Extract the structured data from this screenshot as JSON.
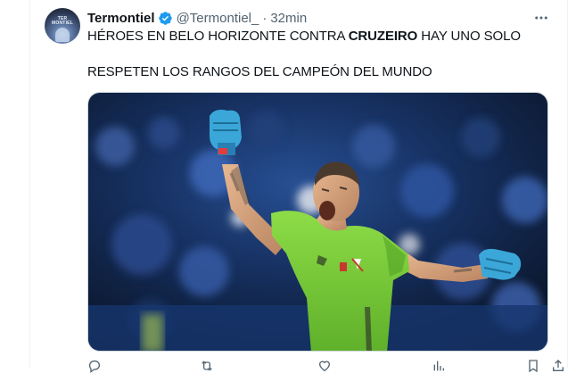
{
  "tweet": {
    "author_name": "Termontiel",
    "handle": "@Termontiel_",
    "separator": "·",
    "time": "32min",
    "text_line1_a": "HÉROES EN BELO HORIZONTE CONTRA ",
    "text_line1_bold": "CRUZEIRO",
    "text_line1_b": " HAY UNO SOLO",
    "text_line2": "RESPETEN LOS RANGOS DEL CAMPEÓN DEL MUNDO",
    "avatar_text": "TER MONTIEL"
  },
  "icons": {
    "verified": "verified-badge-icon",
    "more": "more-options-icon",
    "reply": "reply-icon",
    "retweet": "retweet-icon",
    "like": "heart-icon",
    "views": "views-icon",
    "bookmark": "bookmark-icon",
    "share": "share-icon"
  },
  "colors": {
    "brand_blue": "#1d9bf0",
    "text": "#0f1419",
    "secondary": "#536471",
    "jersey_green": "#7fd13c"
  }
}
